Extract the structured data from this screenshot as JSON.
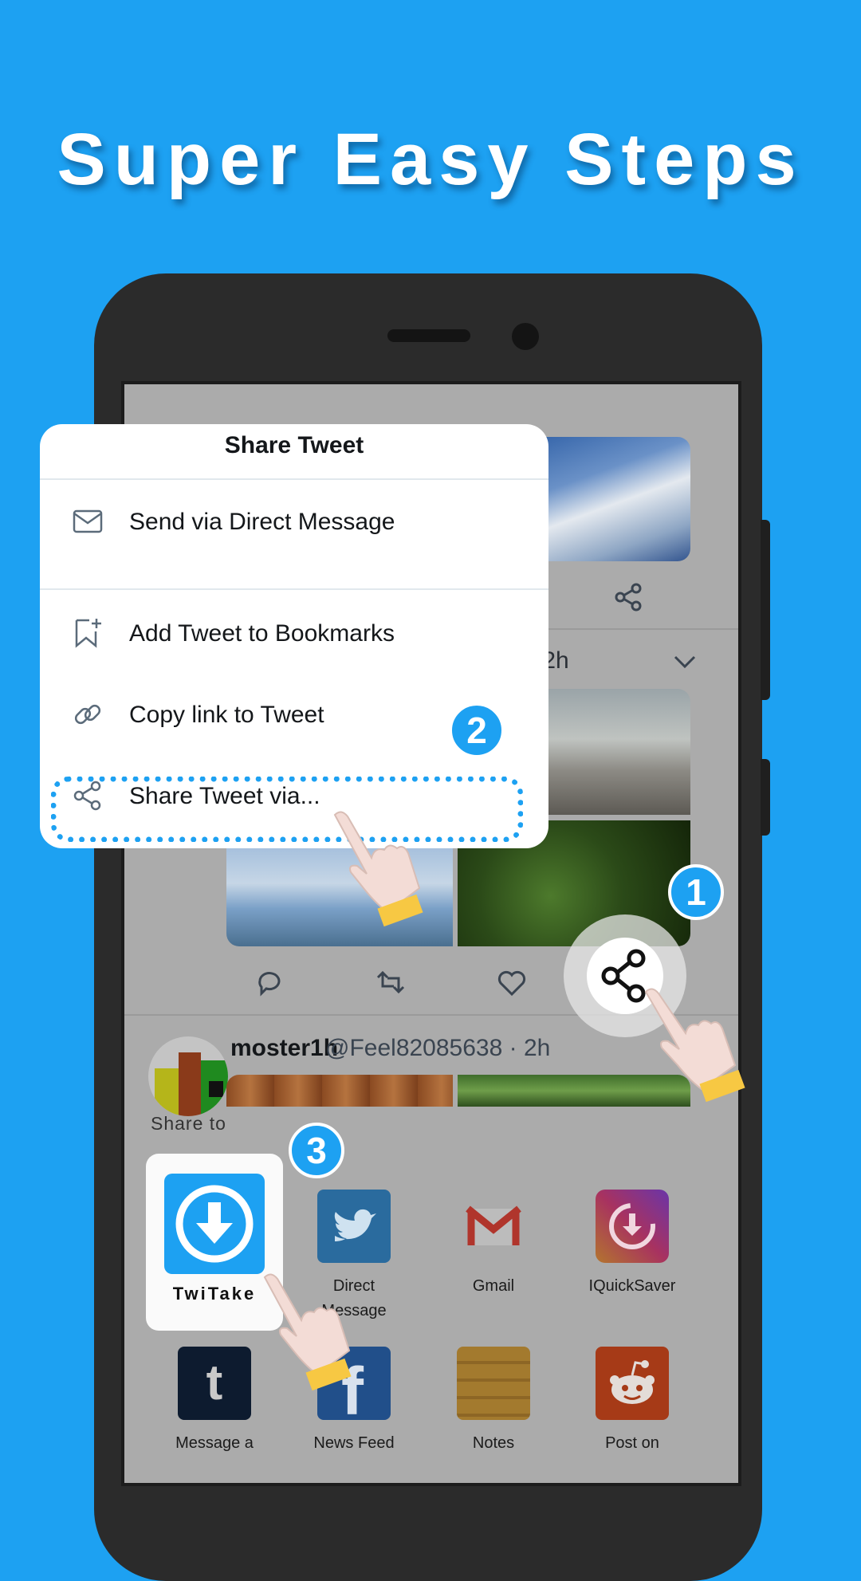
{
  "headline": "Super Easy Steps",
  "feed": {
    "tweet_time_1": "· 2h",
    "user_name": "moster1h",
    "user_handle": "@Feel82085638 · 2h"
  },
  "share_menu": {
    "title": "Share Tweet",
    "items": [
      {
        "label": "Send via Direct Message",
        "icon": "mail-icon"
      },
      {
        "label": "Add Tweet to Bookmarks",
        "icon": "bookmark-add-icon"
      },
      {
        "label": "Copy link to Tweet",
        "icon": "link-icon"
      },
      {
        "label": "Share Tweet via...",
        "icon": "share-icon"
      }
    ]
  },
  "share_sheet": {
    "header": "Share to",
    "apps": [
      {
        "label": "TwiTake",
        "icon": "download-arrow-icon"
      },
      {
        "label": "Direct",
        "label2": "Message",
        "icon": "twitter-bird-icon"
      },
      {
        "label": "Gmail",
        "icon": "gmail-icon"
      },
      {
        "label": "IQuickSaver",
        "icon": "quicksaver-icon"
      },
      {
        "label": "Message a",
        "icon": "tumblr-icon"
      },
      {
        "label": "News Feed",
        "icon": "facebook-icon"
      },
      {
        "label": "Notes",
        "icon": "notes-icon"
      },
      {
        "label": "Post on",
        "icon": "reddit-icon"
      }
    ]
  },
  "steps": [
    "1",
    "2",
    "3"
  ],
  "colors": {
    "accent": "#1da1f2",
    "background": "#1da1f2",
    "phone_body": "#2b2b2b",
    "hand_cuff": "#f7c843"
  }
}
